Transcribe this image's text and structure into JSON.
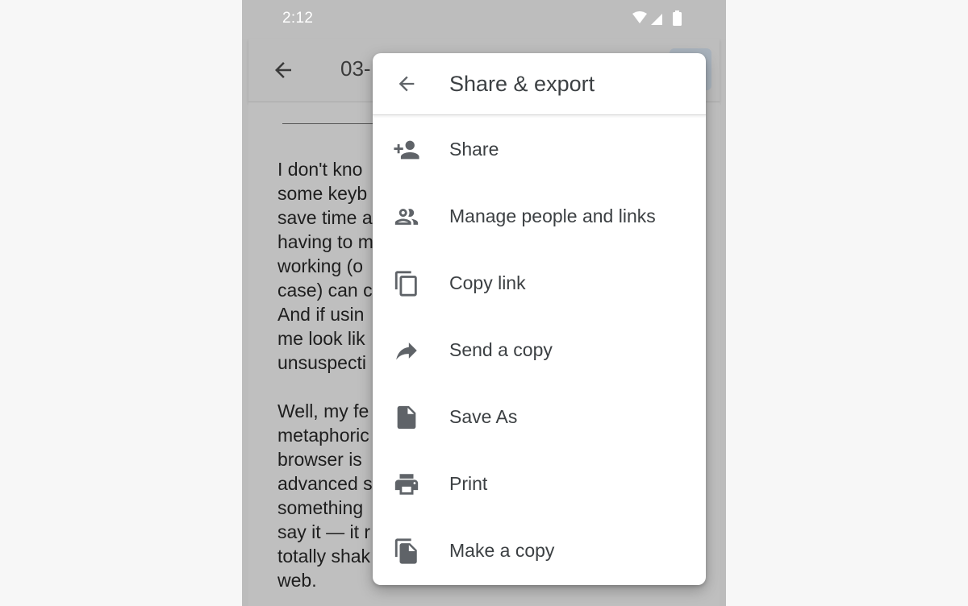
{
  "status_bar": {
    "time": "2:12",
    "icons": [
      "wifi-icon",
      "signal-icon",
      "battery-icon"
    ]
  },
  "toolbar": {
    "doc_title": "03-",
    "back_icon": "arrow-back-icon"
  },
  "document": {
    "paragraphs": [
      [
        "I don't kno",
        "some keyb",
        "save time a",
        "having to m",
        "working (o",
        "case) can c",
        "And if usin",
        "me look lik",
        "unsuspecti"
      ],
      [
        "Well, my fe",
        "metaphoric",
        "browser is",
        "advanced s",
        "something",
        "say it — it r",
        "totally shak",
        "web."
      ]
    ]
  },
  "menu": {
    "title": "Share & export",
    "back_icon": "arrow-back-icon",
    "items": [
      {
        "label": "Share",
        "icon": "person-add-icon"
      },
      {
        "label": "Manage people and links",
        "icon": "people-icon"
      },
      {
        "label": "Copy link",
        "icon": "copy-icon"
      },
      {
        "label": "Send a copy",
        "icon": "forward-arrow-icon"
      },
      {
        "label": "Save As",
        "icon": "file-icon"
      },
      {
        "label": "Print",
        "icon": "print-icon"
      },
      {
        "label": "Make a copy",
        "icon": "file-copy-icon"
      }
    ]
  },
  "colors": {
    "icon": "#5f6368",
    "text": "#3c4043",
    "scrim": "#bdbdbd"
  }
}
